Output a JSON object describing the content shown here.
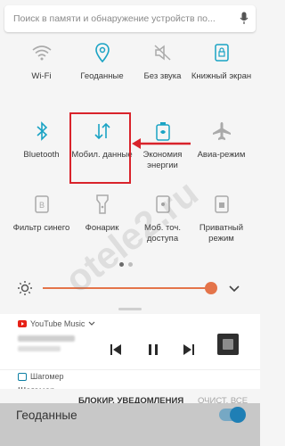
{
  "search": {
    "placeholder": "Поиск в памяти и обнаружение устройств по..."
  },
  "tiles": [
    {
      "label": "Wi-Fi",
      "icon": "wifi-icon"
    },
    {
      "label": "Геоданные",
      "icon": "location-icon"
    },
    {
      "label": "Без звука",
      "icon": "mute-icon"
    },
    {
      "label": "Книжный экран",
      "icon": "portrait-lock-icon"
    },
    {
      "label": "Bluetooth",
      "icon": "bluetooth-icon"
    },
    {
      "label": "Мобил. данные",
      "icon": "mobile-data-icon"
    },
    {
      "label": "Экономия энергии",
      "icon": "battery-saver-icon"
    },
    {
      "label": "Авиа-режим",
      "icon": "airplane-icon"
    },
    {
      "label": "Фильтр синего",
      "icon": "blue-filter-icon"
    },
    {
      "label": "Фонарик",
      "icon": "flashlight-icon"
    },
    {
      "label": "Моб. точ. доступа",
      "icon": "hotspot-icon"
    },
    {
      "label": "Приватный режим",
      "icon": "private-mode-icon"
    }
  ],
  "colors": {
    "accent": "#1aa3c4",
    "highlight": "#d9232b",
    "brightness": "#e4744a"
  },
  "media": {
    "app_name": "YouTube Music"
  },
  "notification": {
    "title": "Шагомер",
    "preview": "Шагомер"
  },
  "actions": {
    "block": "БЛОКИР. УВЕДОМЛЕНИЯ",
    "clear": "ОЧИСТ. ВСЕ"
  },
  "bottom": {
    "title": "Геоданные"
  },
  "watermark": "otele2.ru"
}
